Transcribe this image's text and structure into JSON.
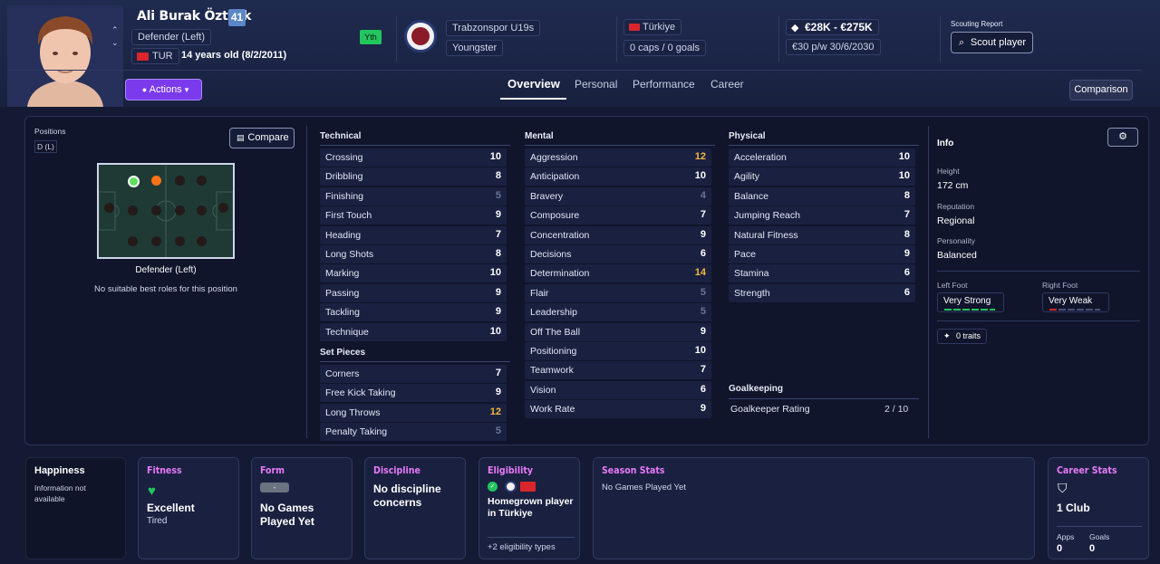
{
  "player": {
    "name": "Ali Burak Öztürk",
    "ca": "41",
    "position": "Defender (Left)",
    "nation_code": "TUR",
    "age": "14 years old (8/2/2011)",
    "youth_tag": "Yth",
    "club": "Trabzonspor U19s",
    "squad_status": "Youngster",
    "nation": "Türkiye",
    "caps": "0 caps / 0 goals",
    "value": "€28K - €275K",
    "wage": "€30 p/w 30/6/2030"
  },
  "header": {
    "scouting_label": "Scouting Report",
    "scout_button": "Scout player",
    "actions_button": "Actions",
    "comparison_button": "Comparison",
    "tabs": [
      "Overview",
      "Personal",
      "Performance",
      "Career"
    ]
  },
  "positions": {
    "title": "Positions",
    "code": "D (L)",
    "compare_button": "Compare",
    "pitch_label": "Defender (Left)",
    "no_roles": "No suitable best roles for this position"
  },
  "technical": {
    "title": "Technical",
    "attrs": [
      {
        "name": "Crossing",
        "value": "10"
      },
      {
        "name": "Dribbling",
        "value": "8"
      },
      {
        "name": "Finishing",
        "value": "5"
      },
      {
        "name": "First Touch",
        "value": "9"
      },
      {
        "name": "Heading",
        "value": "7"
      },
      {
        "name": "Long Shots",
        "value": "8"
      },
      {
        "name": "Marking",
        "value": "10"
      },
      {
        "name": "Passing",
        "value": "9"
      },
      {
        "name": "Tackling",
        "value": "9"
      },
      {
        "name": "Technique",
        "value": "10"
      }
    ]
  },
  "set_pieces": {
    "title": "Set Pieces",
    "attrs": [
      {
        "name": "Corners",
        "value": "7"
      },
      {
        "name": "Free Kick Taking",
        "value": "9"
      },
      {
        "name": "Long Throws",
        "value": "12"
      },
      {
        "name": "Penalty Taking",
        "value": "5"
      }
    ]
  },
  "mental": {
    "title": "Mental",
    "attrs": [
      {
        "name": "Aggression",
        "value": "12"
      },
      {
        "name": "Anticipation",
        "value": "10"
      },
      {
        "name": "Bravery",
        "value": "4"
      },
      {
        "name": "Composure",
        "value": "7"
      },
      {
        "name": "Concentration",
        "value": "9"
      },
      {
        "name": "Decisions",
        "value": "6"
      },
      {
        "name": "Determination",
        "value": "14"
      },
      {
        "name": "Flair",
        "value": "5"
      },
      {
        "name": "Leadership",
        "value": "5"
      },
      {
        "name": "Off The Ball",
        "value": "9"
      },
      {
        "name": "Positioning",
        "value": "10"
      },
      {
        "name": "Teamwork",
        "value": "7"
      },
      {
        "name": "Vision",
        "value": "6"
      },
      {
        "name": "Work Rate",
        "value": "9"
      }
    ]
  },
  "physical": {
    "title": "Physical",
    "attrs": [
      {
        "name": "Acceleration",
        "value": "10"
      },
      {
        "name": "Agility",
        "value": "10"
      },
      {
        "name": "Balance",
        "value": "8"
      },
      {
        "name": "Jumping Reach",
        "value": "7"
      },
      {
        "name": "Natural Fitness",
        "value": "8"
      },
      {
        "name": "Pace",
        "value": "9"
      },
      {
        "name": "Stamina",
        "value": "6"
      },
      {
        "name": "Strength",
        "value": "6"
      }
    ]
  },
  "goalkeeping": {
    "title": "Goalkeeping",
    "label": "Goalkeeper Rating",
    "value": "2 / 10"
  },
  "info": {
    "title": "Info",
    "height_label": "Height",
    "height": "172 cm",
    "reputation_label": "Reputation",
    "reputation": "Regional",
    "personality_label": "Personality",
    "personality": "Balanced",
    "left_foot_label": "Left Foot",
    "left_foot": "Very Strong",
    "right_foot_label": "Right Foot",
    "right_foot": "Very Weak",
    "traits": "0 traits"
  },
  "cards": {
    "happiness": {
      "title": "Happiness",
      "text": "Information not available"
    },
    "fitness": {
      "title": "Fitness",
      "value": "Excellent",
      "sub": "Tired"
    },
    "form": {
      "title": "Form",
      "pill": "-",
      "value": "No Games Played Yet"
    },
    "discipline": {
      "title": "Discipline",
      "value": "No discipline concerns"
    },
    "eligibility": {
      "title": "Eligibility",
      "value": "Homegrown player in Türkiye",
      "more": "+2 eligibility types"
    },
    "season": {
      "title": "Season Stats",
      "text": "No Games Played Yet"
    },
    "career": {
      "title": "Career Stats",
      "clubs": "1 Club",
      "apps_label": "Apps",
      "apps": "0",
      "goals_label": "Goals",
      "goals": "0"
    }
  },
  "colors": {
    "accent": "#8b3cf7",
    "highlight": "#f6b73c",
    "dim": "#6d7391",
    "green": "#22c55e"
  }
}
